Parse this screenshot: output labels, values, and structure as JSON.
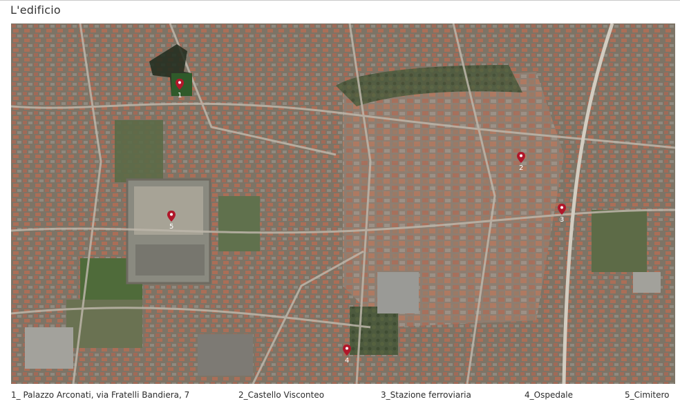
{
  "title": "L'edificio",
  "map": {
    "street_label": "",
    "markers": [
      {
        "number": "1",
        "name": "palazzo-arconati"
      },
      {
        "number": "2",
        "name": "castello-visconteo"
      },
      {
        "number": "3",
        "name": "stazione-ferroviaria"
      },
      {
        "number": "4",
        "name": "ospedale"
      },
      {
        "number": "5",
        "name": "cimitero"
      }
    ],
    "marker_color": "#b0172a"
  },
  "legend": [
    "1_ Palazzo Arconati, via Fratelli Bandiera, 7",
    "2_Castello Visconteo",
    "3_Stazione ferroviaria",
    "4_Ospedale",
    "5_Cimitero"
  ]
}
